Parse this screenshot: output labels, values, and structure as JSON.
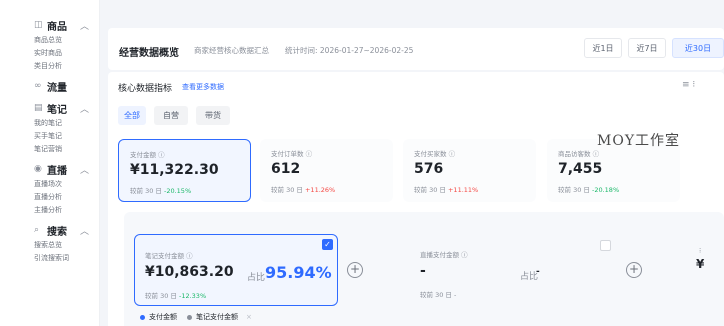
{
  "sidebar": {
    "sections": [
      {
        "icon": "product-icon",
        "glyph": "◫",
        "title": "商品",
        "items": [
          "商品总览",
          "实时商品",
          "类目分析"
        ]
      },
      {
        "icon": "traffic-icon",
        "glyph": "∞",
        "title": "流量",
        "items": []
      },
      {
        "icon": "note-icon",
        "glyph": "▤",
        "title": "笔记",
        "items": [
          "我的笔记",
          "买手笔记",
          "笔记营销"
        ]
      },
      {
        "icon": "live-icon",
        "glyph": "◉",
        "title": "直播",
        "items": [
          "直播场次",
          "直播分析",
          "主播分析"
        ]
      },
      {
        "icon": "search-icon",
        "glyph": "⌕",
        "title": "搜索",
        "items": [
          "搜索总览",
          "引流搜索词"
        ]
      }
    ]
  },
  "overview": {
    "title": "经营数据概览",
    "subtitle": "商家经营核心数据汇总",
    "time": "统计时间: 2026-01-27~2026-02-25",
    "date_tabs": [
      "近1日",
      "近7日",
      "近30日"
    ]
  },
  "core": {
    "title": "核心数据指标",
    "link": "查看更多数据",
    "menu_glyph": "≡ ⁝",
    "filter_tabs": [
      "全部",
      "自营",
      "带货"
    ],
    "metrics": [
      {
        "label": "支付金额 ⓘ",
        "value": "¥11,322.30",
        "cmp_prefix": "较前 30 日",
        "cmp": "-20.15%",
        "trend": "down"
      },
      {
        "label": "支付订单数 ⓘ",
        "value": "612",
        "cmp_prefix": "较前 30 日",
        "cmp": "+11.26%",
        "trend": "up"
      },
      {
        "label": "支付买家数 ⓘ",
        "value": "576",
        "cmp_prefix": "较前 30 日",
        "cmp": "+11.11%",
        "trend": "up"
      },
      {
        "label": "商品访客数 ⓘ",
        "value": "7,455",
        "cmp_prefix": "较前 30 日",
        "cmp": "-20.18%",
        "trend": "down"
      }
    ]
  },
  "watermark": "MOY工作室",
  "combo": {
    "note_card": {
      "label": "笔记支付金额 ⓘ",
      "value": "¥10,863.20",
      "ratio_label": "占比",
      "ratio": "95.94%",
      "cmp_prefix": "较前 30 日",
      "cmp": "-12.33%",
      "checked_glyph": "✓"
    },
    "live_card": {
      "label": "直播支付金额 ⓘ",
      "value": "-",
      "ratio_label": "占比",
      "ratio": "-",
      "cmp_prefix": "较前 30 日",
      "cmp": "-"
    },
    "plus": "+",
    "edge_value": "¥",
    "edge_glyph": "⁝"
  },
  "legend": [
    {
      "label": "支付金额",
      "color": "#2f6bff"
    },
    {
      "label": "笔记支付金额",
      "color": "#8a8f99",
      "close": "×"
    }
  ],
  "colors": {
    "accent": "#2f6bff",
    "up": "#f54a45",
    "down": "#1db86a"
  }
}
